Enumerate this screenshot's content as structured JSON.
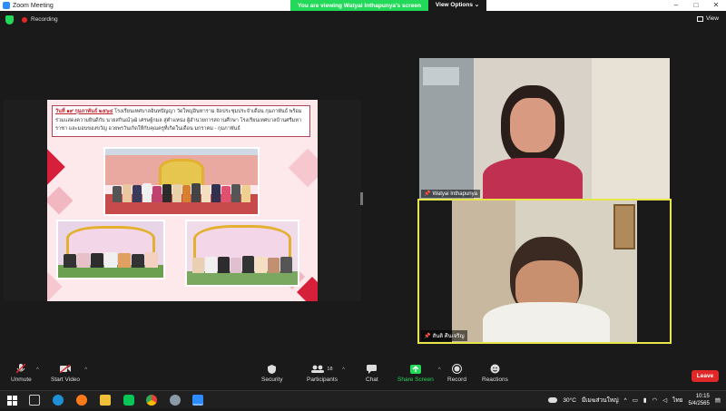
{
  "window": {
    "title": "Zoom Meeting"
  },
  "banner": {
    "message": "You are viewing Watyai Inthapunya's screen",
    "view_options": "View Options"
  },
  "status": {
    "recording_label": "Recording",
    "view_label": "View"
  },
  "slide": {
    "date_prefix": "วันที่ ๑๙ กุมภาพันธ์ ๒๕๖๔",
    "caption": "โรงเรียนเทศบาลอินทปัญญา วัดใหญ่อินทาราม จัดประชุมประจำเดือน กุมภาพันธ์ พร้อมร่วมแสดงความยินดีกับ นายสกินณ์วุฒิ เศรษฐ์กมล สู่ตำแหน่ง ผู้อำนวยการสถานศึกษา โรงเรียนเทศบาลบ้านศรีมหาราชา และมอบของขวัญ อวยพรวันเกิดให้กับคุณครูที่เกิดในเดือน มกราคม - กุมภาพันธ์"
  },
  "participants": [
    {
      "name": "Watyai Inthapunya"
    },
    {
      "name": "สันติ ศีนเจริญ"
    }
  ],
  "toolbar": {
    "unmute": "Unmute",
    "start_video": "Start Video",
    "security": "Security",
    "participants": "Participants",
    "participants_count": "18",
    "chat": "Chat",
    "share_screen": "Share Screen",
    "record": "Record",
    "reactions": "Reactions",
    "leave": "Leave"
  },
  "taskbar": {
    "weather": "30°C",
    "weather_desc": "มีเมฆส่วนใหญ่",
    "lang": "ไทย",
    "time": "10:15",
    "date": "5/4/2565"
  },
  "colors": {
    "accent_green": "#23d959",
    "leave_red": "#e02828",
    "active_speaker": "#e6e64a"
  }
}
